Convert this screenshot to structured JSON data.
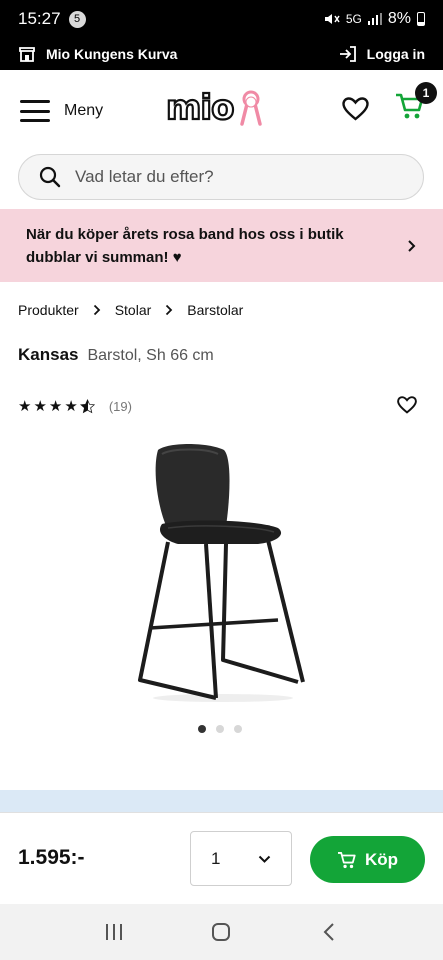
{
  "status": {
    "time": "15:27",
    "notification_count": "5",
    "battery": "8%"
  },
  "store_bar": {
    "store_name": "Mio Kungens Kurva",
    "login_label": "Logga in"
  },
  "header": {
    "menu_label": "Meny",
    "logo_text": "mio",
    "cart_count": "1"
  },
  "search": {
    "placeholder": "Vad letar du efter?"
  },
  "promo": {
    "text": "När du köper årets rosa band hos oss i butik dubblar vi summan! ♥"
  },
  "breadcrumb": [
    "Produkter",
    "Stolar",
    "Barstolar"
  ],
  "product": {
    "name": "Kansas",
    "description": "Barstol, Sh 66 cm",
    "rating": 4.5,
    "review_count": "(19)",
    "price": "1.595:-",
    "quantity": "1",
    "buy_label": "Köp",
    "image_count": 3,
    "active_image": 1
  },
  "colors": {
    "accent_green": "#13a538",
    "promo_pink": "#f6d4dc",
    "strip_blue": "#dbe9f6"
  }
}
